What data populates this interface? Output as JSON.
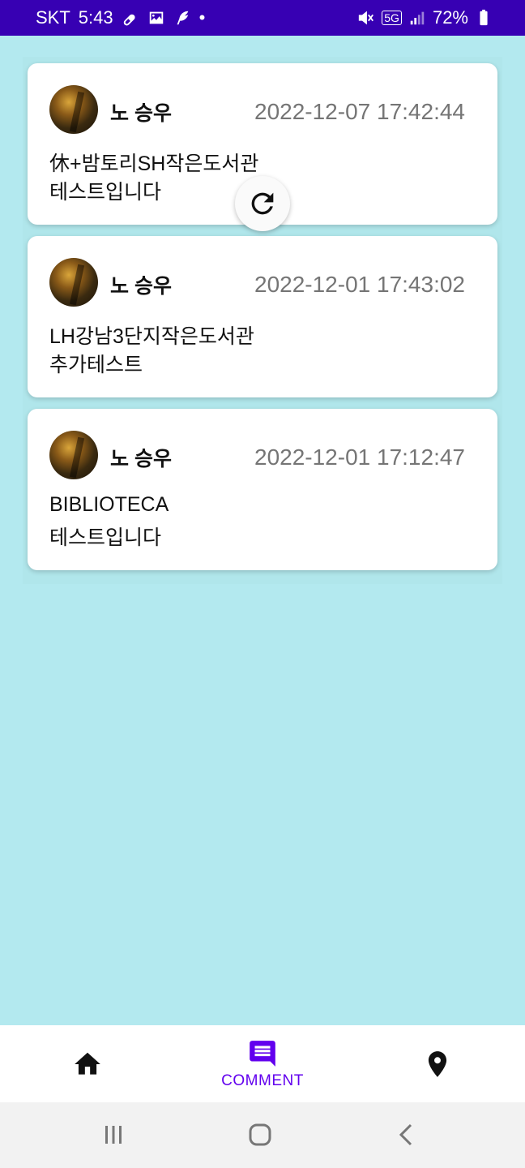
{
  "status_bar": {
    "carrier": "SKT",
    "time": "5:43",
    "network": "5G",
    "battery": "72%"
  },
  "comments": [
    {
      "author": "노 승우",
      "date": "2022-12-07 17:42:44",
      "line1": "休+밤토리SH작은도서관",
      "line2": "테스트입니다"
    },
    {
      "author": "노 승우",
      "date": "2022-12-01 17:43:02",
      "line1": "LH강남3단지작은도서관",
      "line2": "추가테스트"
    },
    {
      "author": "노 승우",
      "date": "2022-12-01 17:12:47",
      "line1": "BIBLIOTECA",
      "line2": "테스트입니다"
    }
  ],
  "bottom_nav": {
    "home_icon": "home-icon",
    "comment_label": "COMMENT",
    "comment_icon": "comment-icon",
    "map_icon": "location-pin-icon",
    "active_color": "#6200ee"
  },
  "colors": {
    "status_bar": "#3700b3",
    "background": "#b3e9ef",
    "date_text": "#757575"
  }
}
